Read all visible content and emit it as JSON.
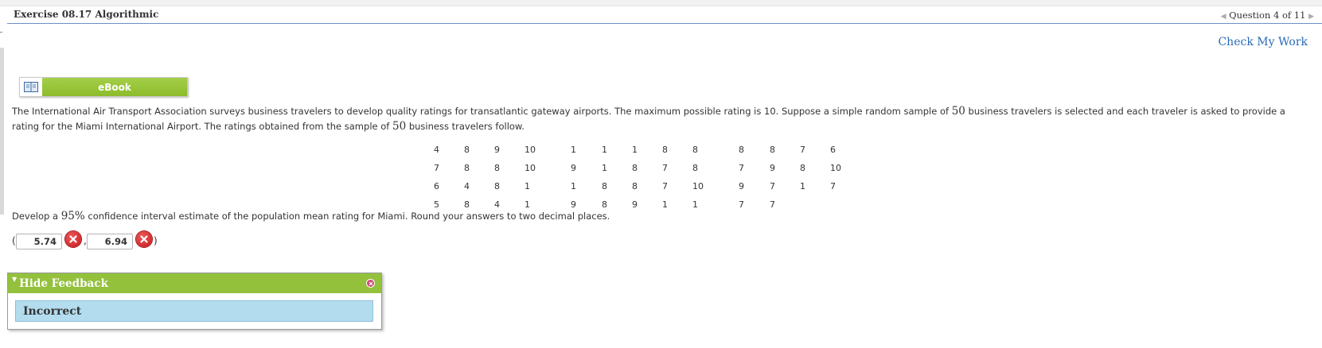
{
  "header": {
    "exercise_title": "Exercise 08.17 Algorithmic",
    "question_nav": "Question 4 of 11"
  },
  "check_my_work": "Check My Work",
  "ebook": {
    "label": "eBook"
  },
  "problem": {
    "text_before_n1": "The International Air Transport Association surveys business travelers to develop quality ratings for transatlantic gateway airports. The maximum possible rating is 10. Suppose a simple random sample of ",
    "n1": "50",
    "text_after_n1": " business travelers is selected and each traveler is asked to provide a rating for the Miami International Airport. The ratings obtained from the sample of ",
    "n2": "50",
    "text_after_n2": " business travelers follow."
  },
  "ratings": [
    [
      "4",
      "8",
      "9",
      "10",
      "1",
      "1",
      "1",
      "8",
      "8",
      "8",
      "8",
      "7",
      "6"
    ],
    [
      "7",
      "8",
      "8",
      "10",
      "9",
      "1",
      "8",
      "7",
      "8",
      "7",
      "9",
      "8",
      "10"
    ],
    [
      "6",
      "4",
      "8",
      "1",
      "1",
      "8",
      "8",
      "7",
      "10",
      "9",
      "7",
      "1",
      "7"
    ],
    [
      "5",
      "8",
      "4",
      "1",
      "9",
      "8",
      "9",
      "1",
      "1",
      "7",
      "7",
      "",
      ""
    ]
  ],
  "instruction": {
    "before": "Develop a ",
    "confidence": "95%",
    "after": " confidence interval estimate of the population mean rating for Miami. Round your answers to two decimal places."
  },
  "answers": {
    "open_paren": "(",
    "separator": ",",
    "close_paren": ")",
    "lower": "5.74",
    "upper": "6.94"
  },
  "feedback": {
    "toggle_label": "Hide Feedback",
    "result": "Incorrect"
  },
  "colors": {
    "ebook_green": "#8cbb2a",
    "feedback_green": "#93c13c",
    "feedback_blue": "#b3dcee",
    "error_red": "#c3181b",
    "link_blue": "#2a6ab6"
  }
}
